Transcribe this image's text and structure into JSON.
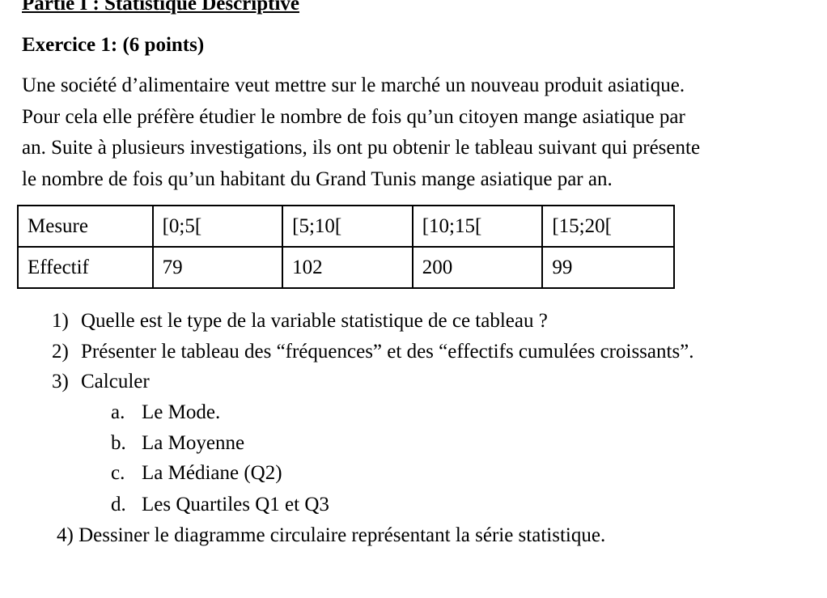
{
  "section": {
    "title": "Partie I : Statistique Descriptive"
  },
  "exercise": {
    "title": "Exercice 1: (6 points)",
    "intro_lines": [
      "Une société d’alimentaire veut mettre sur le marché un nouveau produit asiatique.",
      "Pour cela elle préfère étudier le nombre de fois qu’un citoyen mange asiatique par",
      "an. Suite à plusieurs investigations, ils ont pu obtenir le tableau suivant qui présente",
      "le nombre de fois qu’un habitant du Grand Tunis mange asiatique par an."
    ]
  },
  "table": {
    "rows": [
      {
        "header": "Mesure",
        "cells": [
          "[0;5[",
          "[5;10[",
          "[10;15[",
          "[15;20["
        ]
      },
      {
        "header": "Effectif",
        "cells": [
          "79",
          "102",
          "200",
          "99"
        ]
      }
    ]
  },
  "questions": [
    {
      "number": "1)",
      "text": "Quelle est le type de la variable statistique de ce tableau ?"
    },
    {
      "number": "2)",
      "text": "Présenter le tableau des “fréquences” et des “effectifs cumulées croissants”."
    },
    {
      "number": "3)",
      "text": "Calculer"
    }
  ],
  "subquestions": [
    {
      "letter": "a.",
      "text": "Le Mode."
    },
    {
      "letter": "b.",
      "text": "La Moyenne"
    },
    {
      "letter": "c.",
      "text": "La Médiane (Q2)"
    },
    {
      "letter": "d.",
      "text": "Les Quartiles Q1 et Q3"
    }
  ],
  "final_question": {
    "number": "4)",
    "text": "Dessiner le diagramme circulaire représentant la série statistique."
  }
}
